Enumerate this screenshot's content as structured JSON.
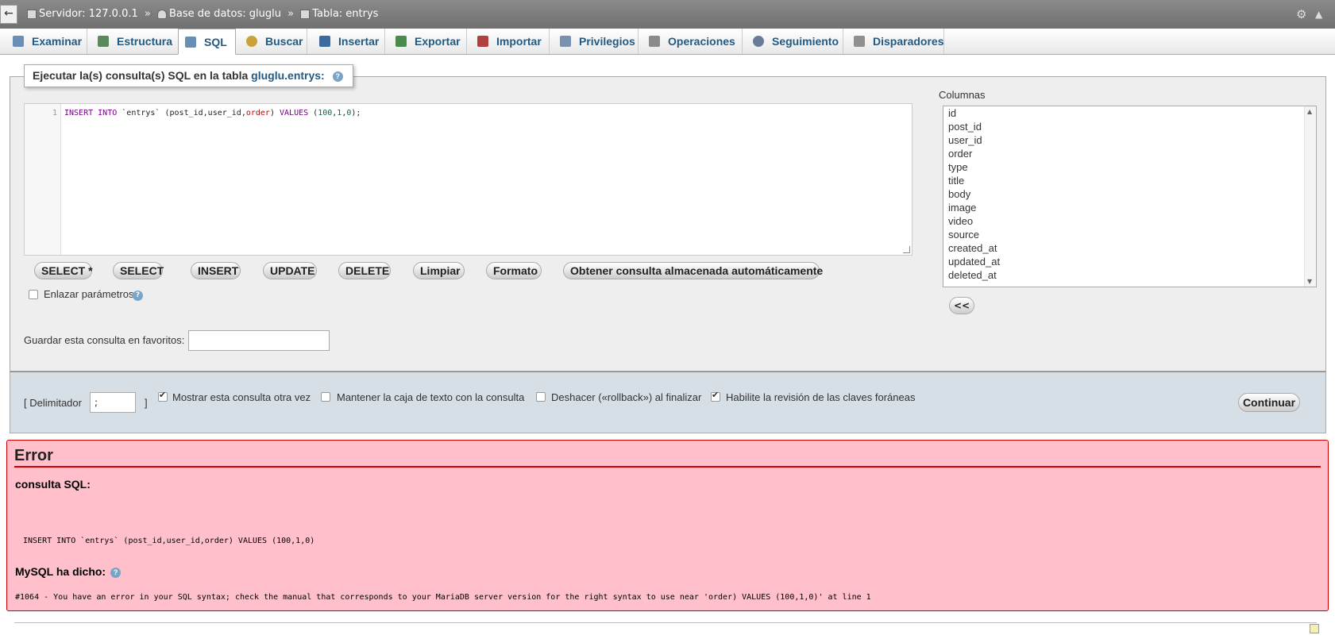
{
  "topbar": {
    "back_label": "←",
    "breadcrumb": {
      "server": "Servidor: 127.0.0.1",
      "database": "Base de datos: gluglu",
      "table": "Tabla: entrys",
      "sep": "»"
    },
    "settings_icon": "gear-icon",
    "collapse_icon": "collapse-icon"
  },
  "tabs": [
    {
      "label": "Examinar",
      "icon": "browse-icon",
      "color": "#6a8fb5"
    },
    {
      "label": "Estructura",
      "icon": "structure-icon",
      "color": "#5a8a5a"
    },
    {
      "label": "SQL",
      "icon": "sql-icon",
      "color": "#6a8fb5",
      "active": true
    },
    {
      "label": "Buscar",
      "icon": "search-icon",
      "color": "#c9a23a"
    },
    {
      "label": "Insertar",
      "icon": "insert-icon",
      "color": "#3a6aa0"
    },
    {
      "label": "Exportar",
      "icon": "export-icon",
      "color": "#4a8a4a"
    },
    {
      "label": "Importar",
      "icon": "import-icon",
      "color": "#b04040"
    },
    {
      "label": "Privilegios",
      "icon": "privileges-icon",
      "color": "#7a90b0"
    },
    {
      "label": "Operaciones",
      "icon": "operations-icon",
      "color": "#8a8a8a"
    },
    {
      "label": "Seguimiento",
      "icon": "tracking-icon",
      "color": "#6a7a9a"
    },
    {
      "label": "Disparadores",
      "icon": "triggers-icon",
      "color": "#909090"
    }
  ],
  "sql_panel": {
    "legend_prefix": "Ejecutar la(s) consulta(s) SQL en la tabla",
    "legend_table": "gluglu.entrys:",
    "line_number": "1",
    "code": {
      "kw_insert": "INSERT",
      "kw_into": "INTO",
      "table": "`entrys`",
      "cols_open": "(post_id,user_id,",
      "col_order": "order",
      "cols_close": ")",
      "kw_values": "VALUES",
      "vals_open": "(",
      "v1": "100",
      "c1": ",",
      "v2": "1",
      "c2": ",",
      "v3": "0",
      "vals_close": ");"
    },
    "buttons": {
      "select_star": "SELECT *",
      "select": "SELECT",
      "insert": "INSERT",
      "update": "UPDATE",
      "delete": "DELETE",
      "clear": "Limpiar",
      "format": "Formato",
      "autosaved": "Obtener consulta almacenada automáticamente"
    },
    "bind_params_label": "Enlazar parámetros",
    "bind_params_checked": false,
    "favorites_label": "Guardar esta consulta en favoritos:",
    "favorites_value": ""
  },
  "columns": {
    "label": "Columnas",
    "items": [
      "id",
      "post_id",
      "user_id",
      "order",
      "type",
      "title",
      "body",
      "image",
      "video",
      "source",
      "created_at",
      "updated_at",
      "deleted_at"
    ],
    "insert_button": "<<"
  },
  "options": {
    "delimiter_label": "[ Delimitador",
    "delimiter_close": "]",
    "delimiter_value": ";",
    "show_again_label": "Mostrar esta consulta otra vez",
    "show_again_checked": true,
    "retain_box_label": "Mantener la caja de texto con la consulta",
    "retain_box_checked": false,
    "rollback_label": "Deshacer («rollback») al finalizar",
    "rollback_checked": false,
    "fk_checks_label": "Habilite la revisión de las claves foráneas",
    "fk_checks_checked": true,
    "continue_label": "Continuar"
  },
  "error": {
    "title": "Error",
    "sql_label": "consulta SQL:",
    "sql_text": "INSERT INTO `entrys` (post_id,user_id,order) VALUES (100,1,0)",
    "mysql_label": "MySQL ha dicho:",
    "message": "#1064 - You have an error in your SQL syntax; check the manual that corresponds to your MariaDB server version for the right syntax to use near 'order) VALUES (100,1,0)' at line 1"
  },
  "colors": {
    "link": "#235a81",
    "error_bg": "#ffc0cb",
    "error_border": "#cc0000",
    "panel_bg": "#eeeeee",
    "options_bg": "#d6dee6"
  }
}
